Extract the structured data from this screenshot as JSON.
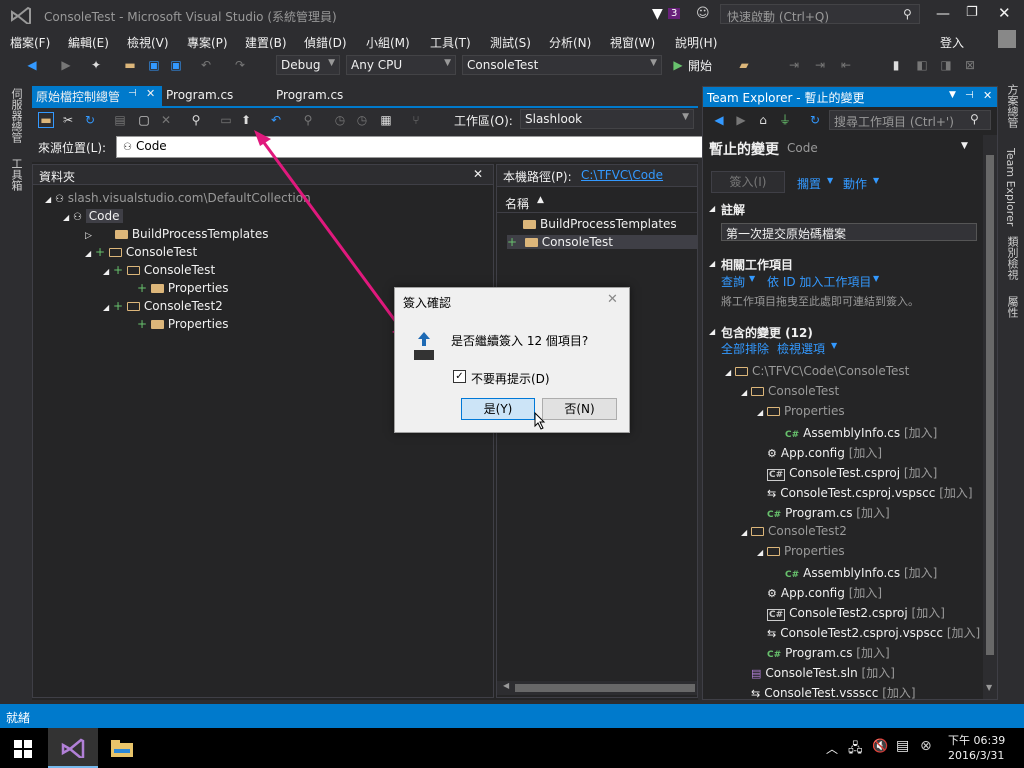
{
  "window": {
    "title": "ConsoleTest - Microsoft Visual Studio (系統管理員)",
    "notification_count": "3",
    "quick_launch_placeholder": "快速啟動 (Ctrl+Q)",
    "user": "登入"
  },
  "menu": [
    "檔案(F)",
    "編輯(E)",
    "檢視(V)",
    "專案(P)",
    "建置(B)",
    "偵錯(D)",
    "小組(M)",
    "工具(T)",
    "測試(S)",
    "分析(N)",
    "視窗(W)",
    "說明(H)"
  ],
  "toolbar": {
    "configuration": "Debug",
    "platform": "Any CPU",
    "startup_project": "ConsoleTest",
    "start_label": "開始"
  },
  "left_tabs": [
    "伺服器總管",
    "工具箱"
  ],
  "doc_tabs": [
    "原始檔控制總管",
    "Program.cs",
    "Program.cs"
  ],
  "source_control": {
    "workspace_label": "工作區(O):",
    "workspace_value": "Slashlook",
    "source_location_label": "來源位置(L):",
    "source_location_value": "Code",
    "folders_header": "資料夾",
    "tree": [
      {
        "label": "slash.visualstudio.com\\DefaultCollection"
      },
      {
        "label": "Code"
      },
      {
        "label": "BuildProcessTemplates"
      },
      {
        "label": "ConsoleTest"
      },
      {
        "label": "ConsoleTest"
      },
      {
        "label": "Properties"
      },
      {
        "label": "ConsoleTest2"
      },
      {
        "label": "Properties"
      }
    ],
    "local_path_label": "本機路徑(P):",
    "local_path_value": "C:\\TFVC\\Code",
    "name_column": "名稱",
    "items": [
      "BuildProcessTemplates",
      "ConsoleTest"
    ]
  },
  "team_explorer": {
    "title": "Team Explorer - 暫止的變更",
    "search_placeholder": "搜尋工作項目 (Ctrl+')",
    "page_title": "暫止的變更",
    "page_sub": "Code",
    "checkin_button": "簽入(I)",
    "shelve_link": "擱置",
    "actions_link": "動作",
    "comment_header": "註解",
    "comment_value": "第一次提交原始碼檔案",
    "related_header": "相關工作項目",
    "query_link": "查詢",
    "add_by_id_link": "依 ID 加入工作項目",
    "drag_hint": "將工作項目拖曳至此處即可連結到簽入。",
    "included_header": "包含的變更 (12)",
    "exclude_all_link": "全部排除",
    "view_options_link": "檢視選項",
    "changes": [
      {
        "name": "C:\\TFVC\\Code\\ConsoleTest",
        "tag": ""
      },
      {
        "name": "ConsoleTest",
        "tag": ""
      },
      {
        "name": "Properties",
        "tag": ""
      },
      {
        "name": "AssemblyInfo.cs",
        "tag": "[加入]"
      },
      {
        "name": "App.config",
        "tag": "[加入]"
      },
      {
        "name": "ConsoleTest.csproj",
        "tag": "[加入]"
      },
      {
        "name": "ConsoleTest.csproj.vspscc",
        "tag": "[加入]"
      },
      {
        "name": "Program.cs",
        "tag": "[加入]"
      },
      {
        "name": "ConsoleTest2",
        "tag": ""
      },
      {
        "name": "Properties",
        "tag": ""
      },
      {
        "name": "AssemblyInfo.cs",
        "tag": "[加入]"
      },
      {
        "name": "App.config",
        "tag": "[加入]"
      },
      {
        "name": "ConsoleTest2.csproj",
        "tag": "[加入]"
      },
      {
        "name": "ConsoleTest2.csproj.vspscc",
        "tag": "[加入]"
      },
      {
        "name": "Program.cs",
        "tag": "[加入]"
      },
      {
        "name": "ConsoleTest.sln",
        "tag": "[加入]"
      },
      {
        "name": "ConsoleTest.vssscc",
        "tag": "[加入]"
      }
    ]
  },
  "right_tabs": [
    "方案總管",
    "Team Explorer",
    "類別檢視",
    "屬性"
  ],
  "dialog": {
    "title": "簽入確認",
    "message": "是否繼續簽入 12 個項目?",
    "checkbox_label": "不要再提示(D)",
    "yes_button": "是(Y)",
    "no_button": "否(N)"
  },
  "status": {
    "text": "就緒"
  },
  "taskbar": {
    "time": "下午 06:39",
    "date": "2016/3/31"
  },
  "colors": {
    "accent": "#007acc",
    "background": "#2d2d30",
    "arrow": "#e0197d"
  }
}
